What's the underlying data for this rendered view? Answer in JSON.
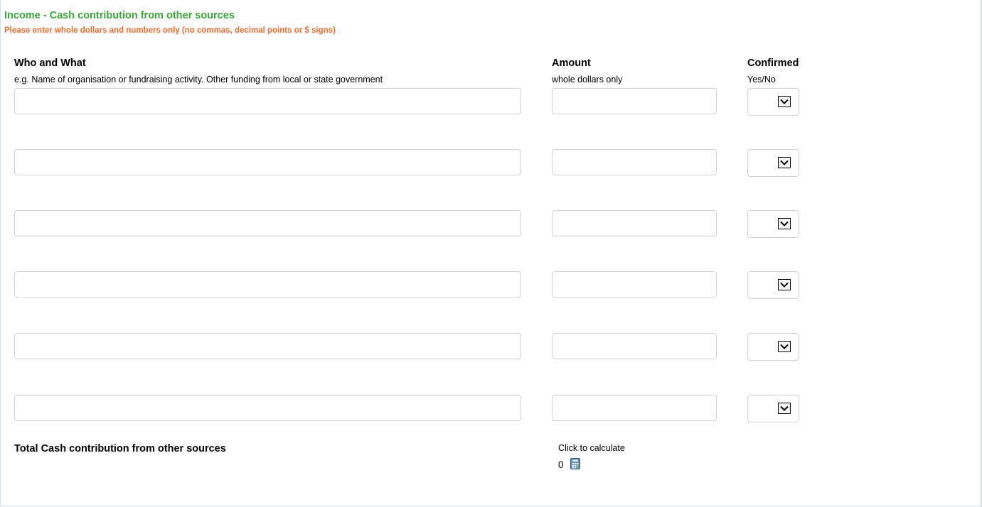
{
  "section": {
    "title": "Income - Cash contribution from other sources",
    "note": "Please enter whole dollars and numbers only (no commas, decimal points or $ signs)"
  },
  "columns": {
    "who": {
      "heading": "Who and What",
      "hint": "e.g. Name of organisation or fundraising activity. Other funding from local or state government"
    },
    "amount": {
      "heading": "Amount",
      "hint": "whole dollars only"
    },
    "confirmed": {
      "heading": "Confirmed",
      "hint": "Yes/No"
    }
  },
  "rows": [
    {
      "who": "",
      "amount": "",
      "confirmed": ""
    },
    {
      "who": "",
      "amount": "",
      "confirmed": ""
    },
    {
      "who": "",
      "amount": "",
      "confirmed": ""
    },
    {
      "who": "",
      "amount": "",
      "confirmed": ""
    },
    {
      "who": "",
      "amount": "",
      "confirmed": ""
    },
    {
      "who": "",
      "amount": "",
      "confirmed": ""
    }
  ],
  "total": {
    "label": "Total Cash contribution from other sources",
    "calc_label": "Click to calculate",
    "value": "0",
    "calc_icon": "calculator-icon"
  },
  "colors": {
    "title": "#3aa63a",
    "note": "#f26b2e",
    "field_border": "#d3d3d3",
    "panel_border": "#cfe0ee"
  }
}
